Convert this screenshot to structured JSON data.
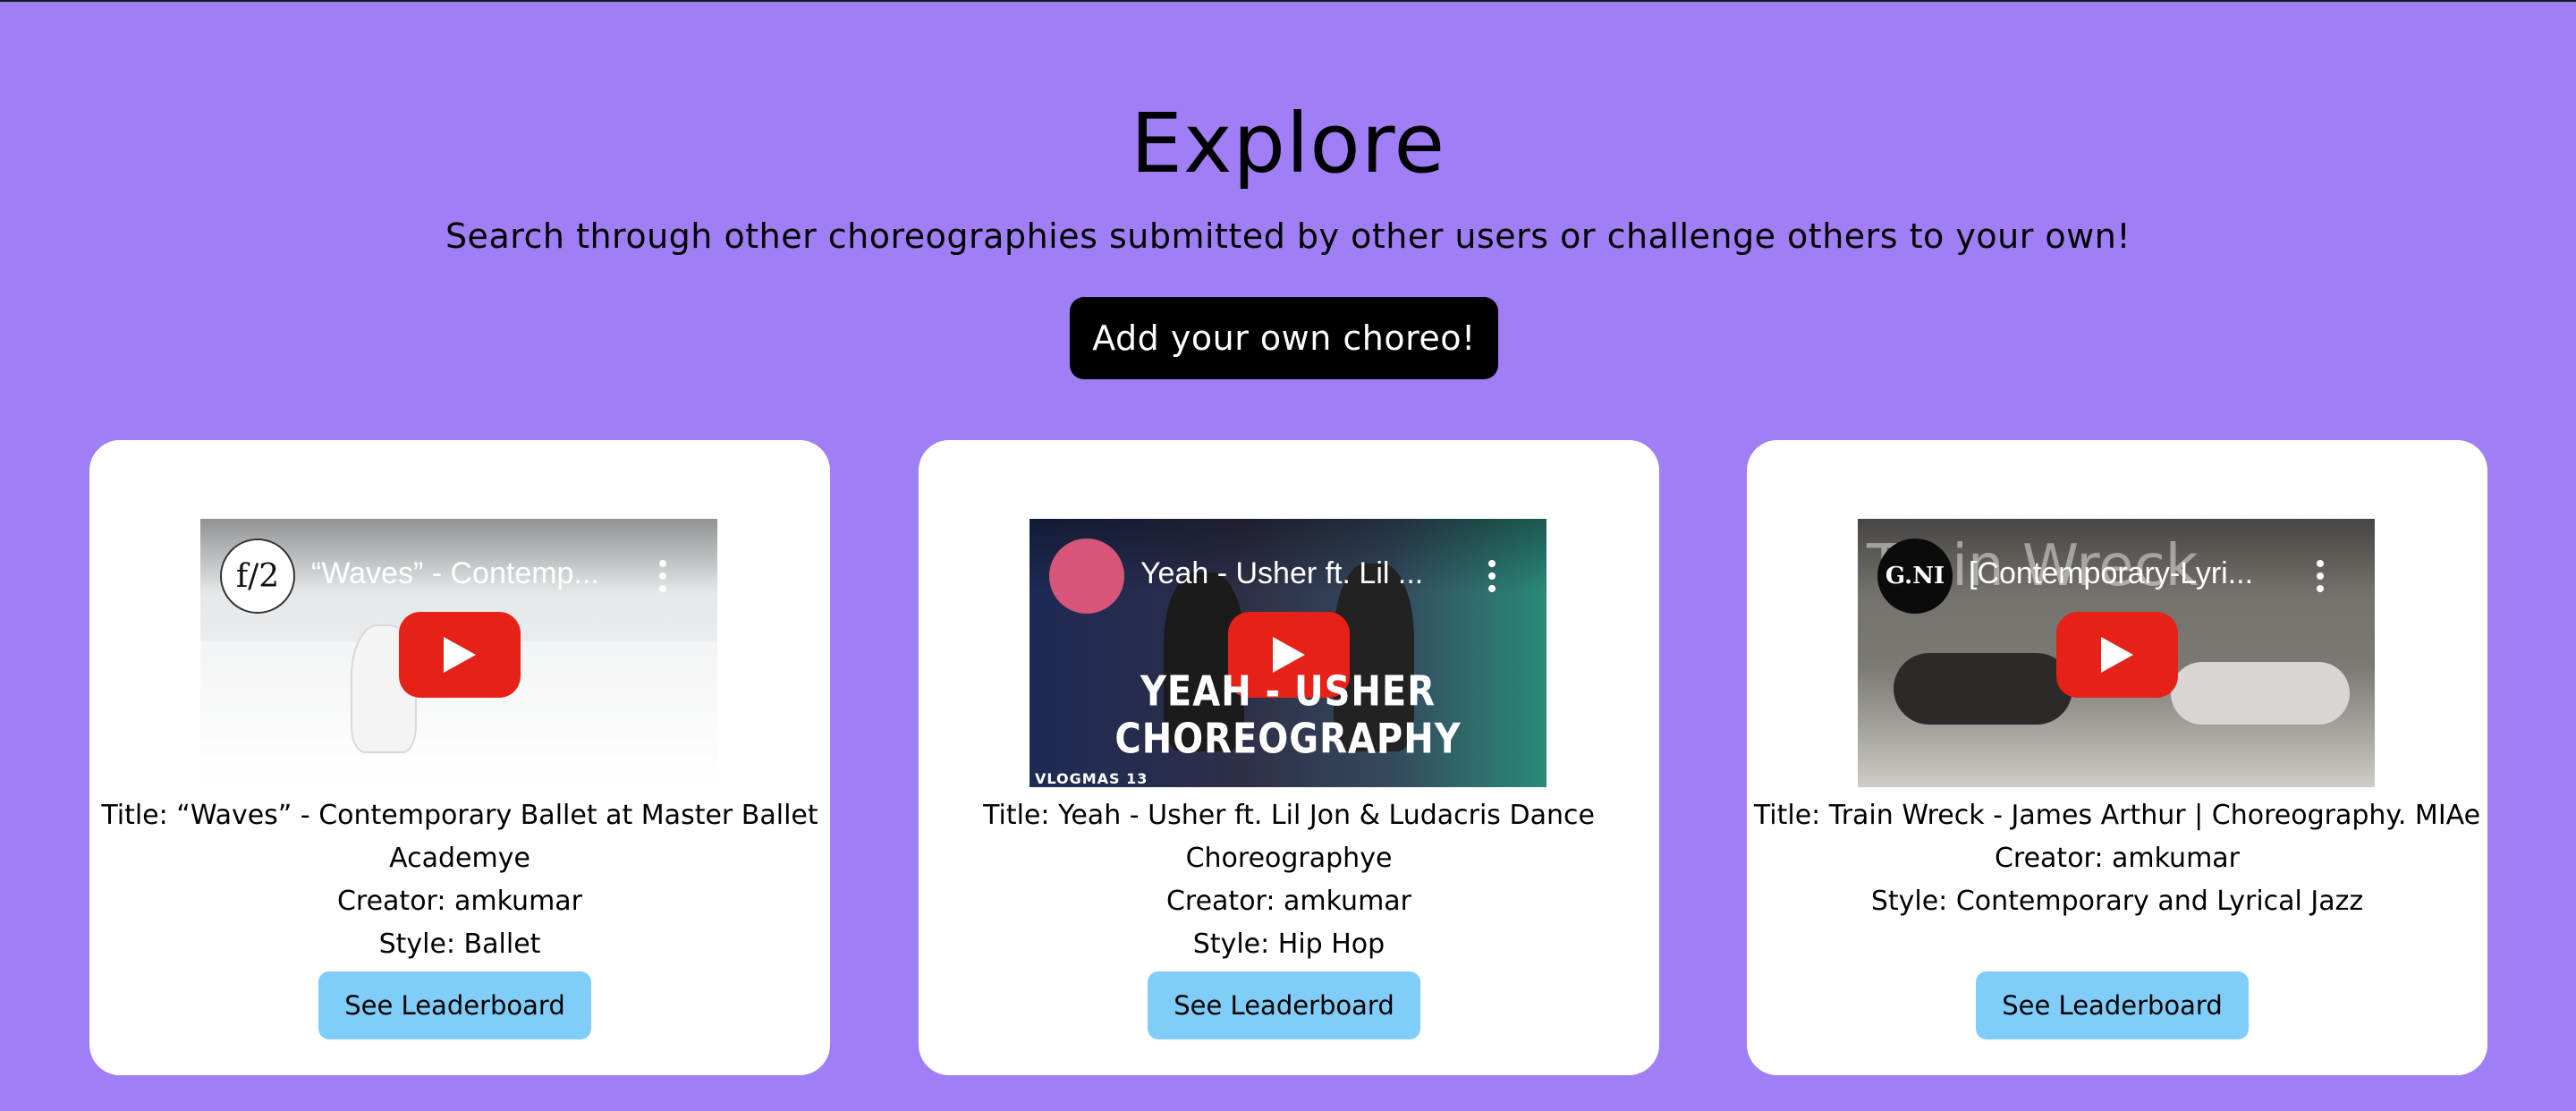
{
  "header": {
    "title": "Explore",
    "subtitle": "Search through other choreographies submitted by other users or challenge others to your own!",
    "add_button_label": "Add your own choreo!"
  },
  "colors": {
    "page_background": "#a07ef6",
    "card_background": "#ffffff",
    "add_button_background": "#000000",
    "leaderboard_button_background": "#7fcdf8",
    "youtube_red": "#e62117"
  },
  "cards": [
    {
      "video": {
        "title": "“Waves” - Contemp...",
        "channel_avatar_text": "f/2",
        "play_icon": "youtube-play-icon",
        "menu_icon": "kebab-menu-icon"
      },
      "title_line": "Title: “Waves” - Contemporary Ballet at Master Ballet Academye",
      "creator_line": "Creator: amkumar",
      "style_line": "Style: Ballet",
      "button_label": "See Leaderboard"
    },
    {
      "video": {
        "title": "Yeah - Usher ft. Lil ...",
        "channel_avatar_text": "",
        "caption": "YEAH - USHER CHOREOGRAPHY",
        "tag": "VLOGMAS 13",
        "play_icon": "youtube-play-icon",
        "menu_icon": "kebab-menu-icon"
      },
      "title_line": "Title: Yeah - Usher ft. Lil Jon & Ludacris Dance Choreographye",
      "creator_line": "Creator: amkumar",
      "style_line": "Style: Hip Hop",
      "button_label": "See Leaderboard"
    },
    {
      "video": {
        "title": "[Contemporary-Lyri...",
        "channel_avatar_text": "G.NI",
        "background_text": "Train Wreck",
        "play_icon": "youtube-play-icon",
        "menu_icon": "kebab-menu-icon"
      },
      "title_line": "Title: Train Wreck - James Arthur | Choreography. MIAe",
      "creator_line": "Creator: amkumar",
      "style_line": "Style: Contemporary and Lyrical Jazz",
      "button_label": "See Leaderboard"
    }
  ]
}
